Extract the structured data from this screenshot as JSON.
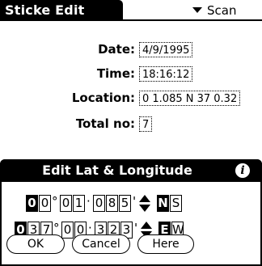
{
  "app": {
    "title": "Sticke Edit",
    "category_picker": "Scan"
  },
  "form": {
    "date_label": "Date:",
    "date_value": "4/9/1995",
    "time_label": "Time:",
    "time_value": "18:16:12",
    "location_label": "Location:",
    "location_value": "0 1.085 N 37 0.32",
    "total_label": "Total no:",
    "total_value": "7"
  },
  "dialog": {
    "title": "Edit Lat & Longitude",
    "info_icon": "i",
    "latitude": {
      "deg": [
        "0",
        "0"
      ],
      "min": [
        "0",
        "1"
      ],
      "sec": [
        "0",
        "8",
        "5"
      ],
      "hemisphere": [
        "N",
        "S"
      ],
      "selected": "N"
    },
    "longitude": {
      "deg": [
        "0",
        "3",
        "7"
      ],
      "min": [
        "0",
        "0"
      ],
      "sec": [
        "3",
        "2",
        "3"
      ],
      "hemisphere": [
        "E",
        "W"
      ],
      "selected": "E"
    },
    "degree_symbol": "°",
    "separator": "·",
    "minute_symbol": "'",
    "buttons": {
      "ok": "OK",
      "cancel": "Cancel",
      "here": "Here"
    }
  }
}
